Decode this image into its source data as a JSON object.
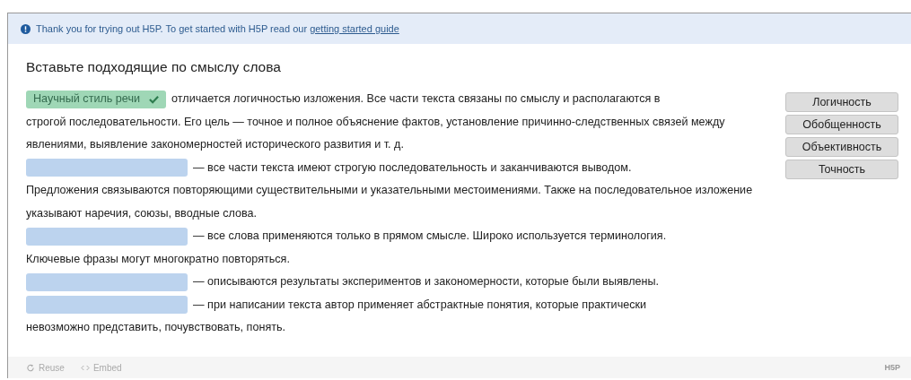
{
  "notice": {
    "text": "Thank you for trying out H5P. To get started with H5P read our ",
    "link": "getting started guide"
  },
  "task": {
    "title": "Вставьте подходящие по смыслу  слова"
  },
  "segments": [
    {
      "kind": "filled",
      "answer": "Научный стиль речи",
      "correct": true,
      "text": "отличается логичностью изложения. Все части текста связаны по смыслу и располагаются в",
      "more": "строгой последовательности. Его цель — точное и полное объяснение фактов, установление причинно-следственных связей между явлениями, выявление закономерностей исторического развития и т. д."
    },
    {
      "kind": "empty",
      "text": "— все части текста имеют строгую последовательность и заканчиваются выводом.",
      "more": "Предложения связываются повторяющими существительными и указательными местоимениями. Также на последовательное изложение указывают наречия, союзы, вводные слова."
    },
    {
      "kind": "empty",
      "text": "— все слова применяются только в прямом смысле. Широко используется терминология.",
      "more": "Ключевые фразы могут многократно повторяться."
    },
    {
      "kind": "empty",
      "text": "— описываются результаты экспериментов и закономерности, которые были выявлены."
    },
    {
      "kind": "empty",
      "text": "— при написании текста автор применяет абстрактные понятия, которые практически",
      "more": "невозможно представить, почувствовать, понять."
    }
  ],
  "words": [
    "Логичность",
    "Обобщенность",
    "Объективность",
    "Точность"
  ],
  "footer": {
    "reuse": "Reuse",
    "embed": "Embed",
    "logo": "H5P"
  }
}
